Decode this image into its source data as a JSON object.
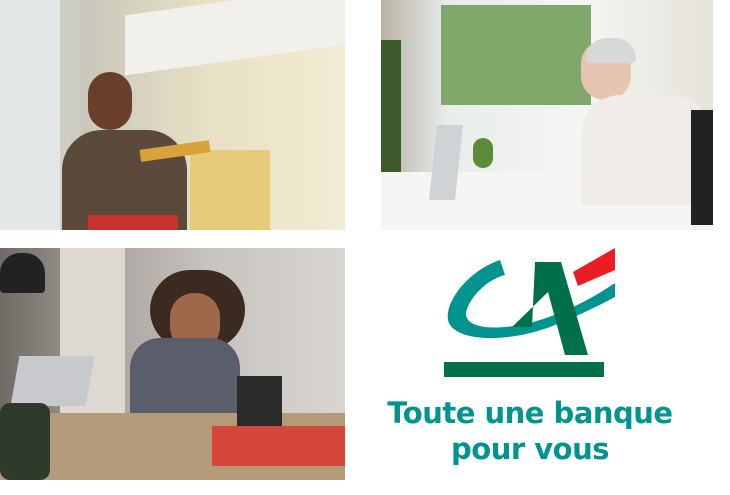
{
  "photos": [
    {
      "subject": "man-with-caulking-gun"
    },
    {
      "subject": "woman-on-phone-at-laptop"
    },
    {
      "subject": "woman-writing-at-desk"
    }
  ],
  "logo": {
    "text": "CA",
    "colors": {
      "teal": "#009491",
      "green": "#00704a",
      "red": "#ed1c24"
    }
  },
  "slogan": {
    "line1": "Toute une banque",
    "line2": "pour vous"
  }
}
